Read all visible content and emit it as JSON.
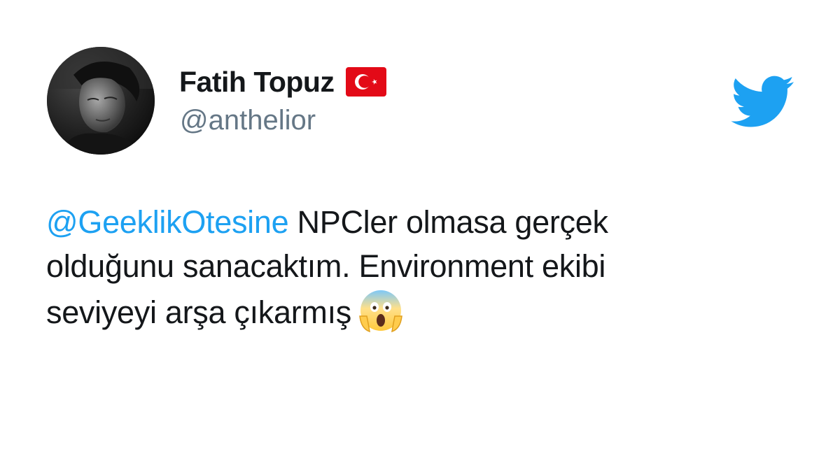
{
  "user": {
    "display_name": "Fatih Topuz",
    "handle": "@anthelior",
    "flag_icon": "turkey-flag-icon"
  },
  "tweet": {
    "mention": "@GeeklikOtesine",
    "text": " NPCler olmasa gerçek olduğunu sanacaktım. Environment ekibi seviyeyi arşa çıkarmış",
    "emoji_icon": "face-screaming-in-fear-icon"
  },
  "brand": {
    "logo_icon": "twitter-bird-icon",
    "accent_color": "#1DA1F2",
    "text_color": "#14171A",
    "muted_color": "#657786"
  }
}
